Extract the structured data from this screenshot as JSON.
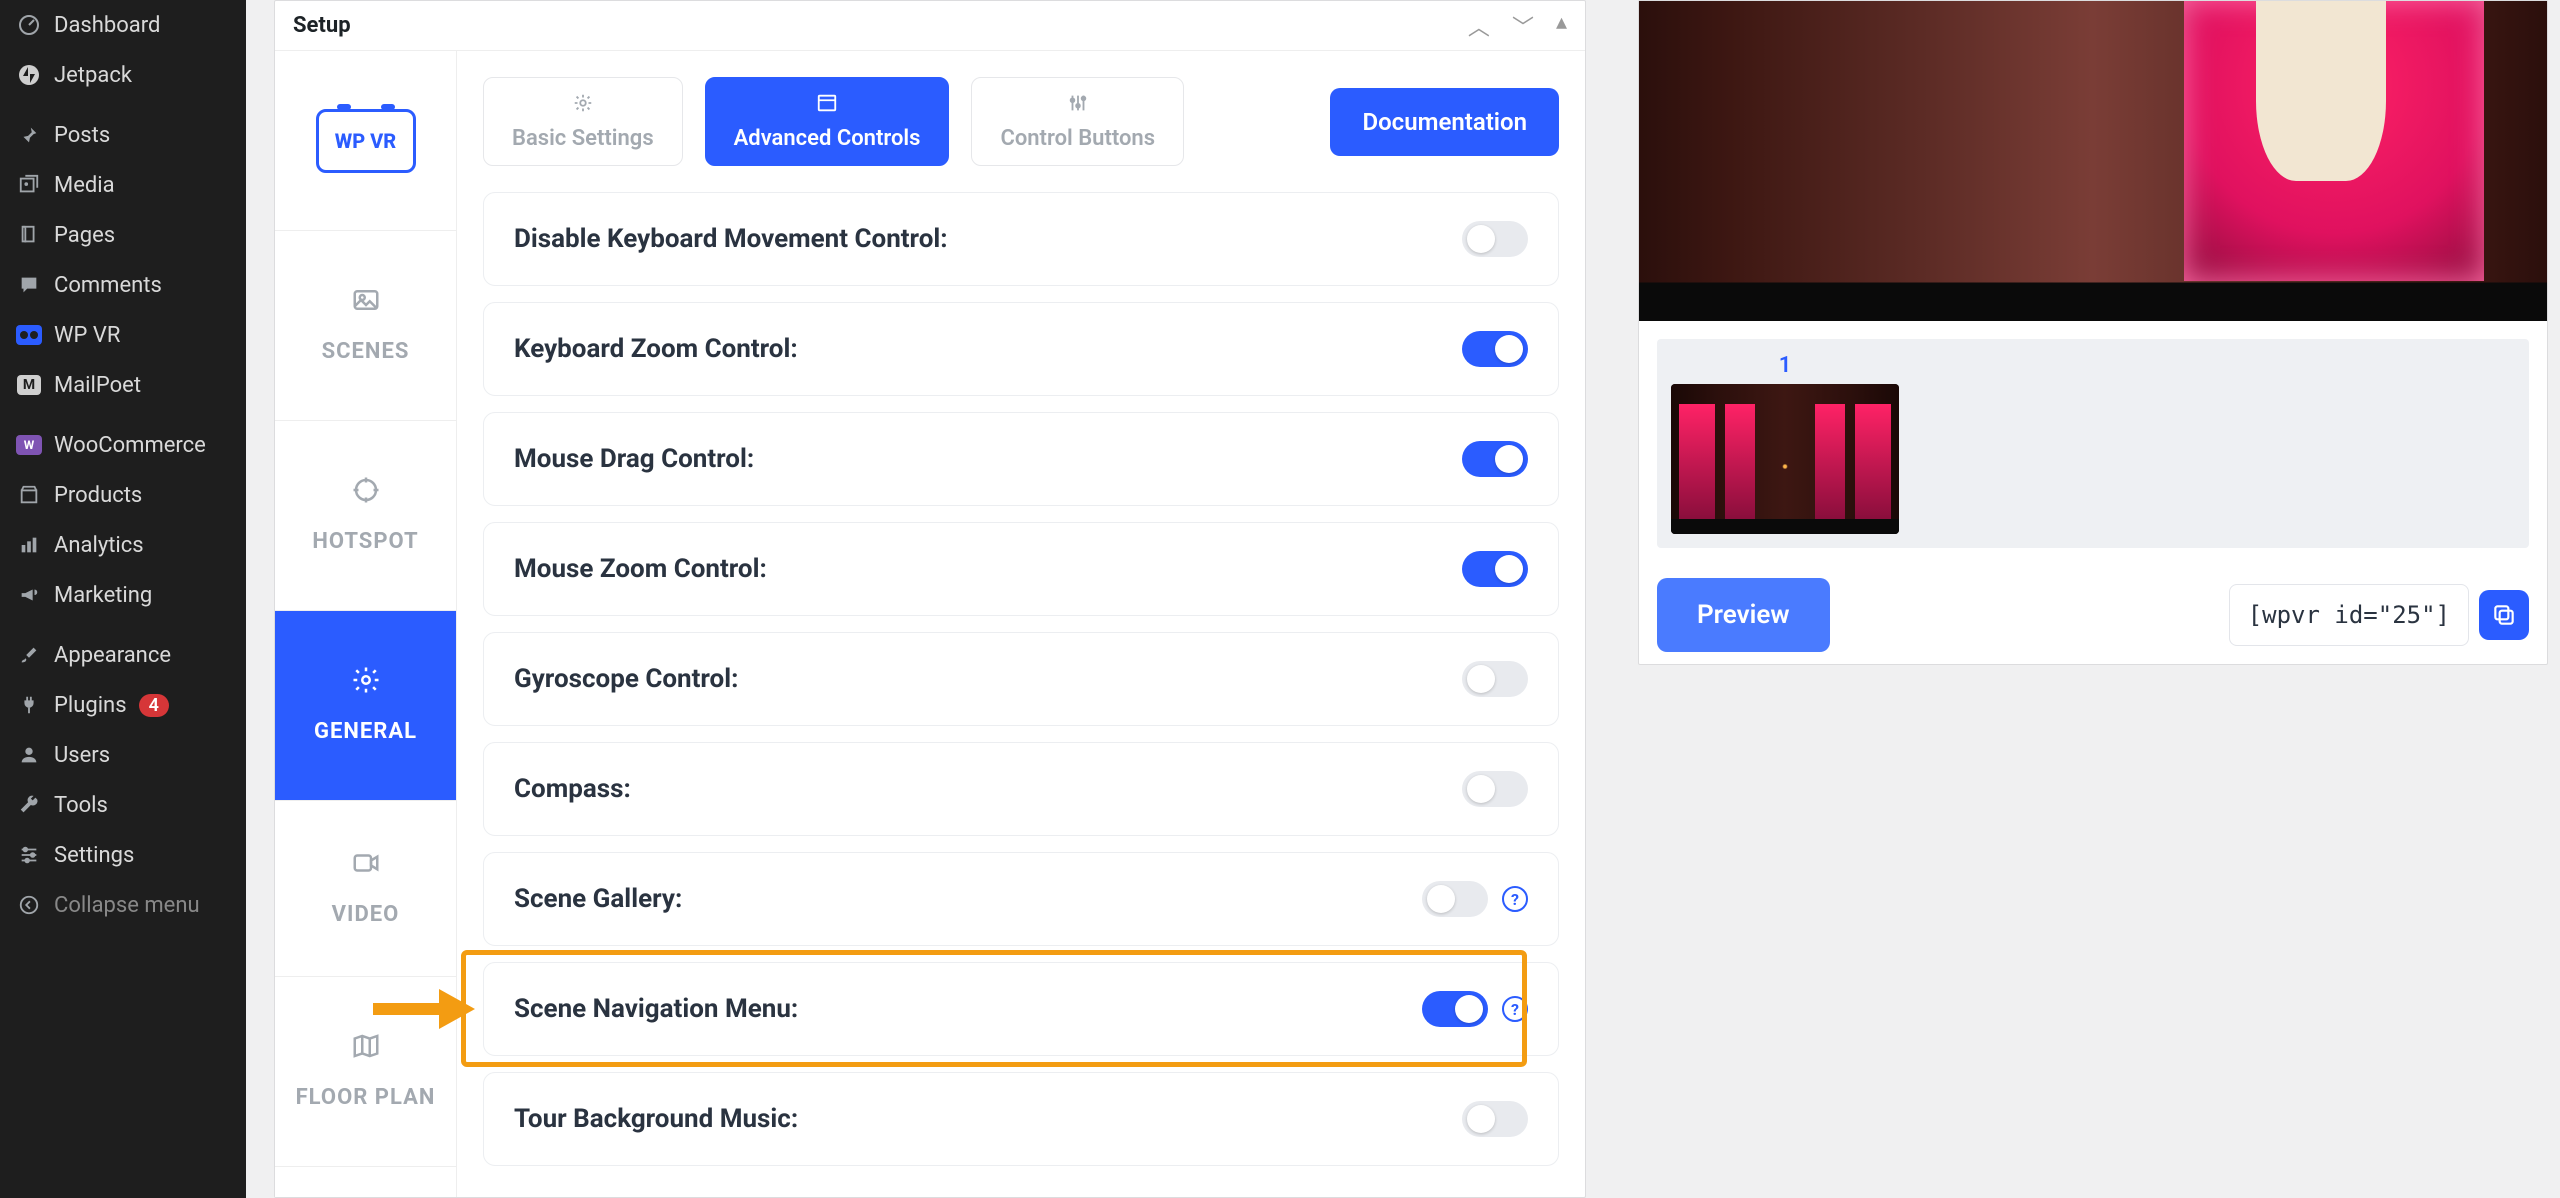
{
  "wp_menu": {
    "dashboard": "Dashboard",
    "jetpack": "Jetpack",
    "posts": "Posts",
    "media": "Media",
    "pages": "Pages",
    "comments": "Comments",
    "wpvr": "WP VR",
    "mailpoet": "MailPoet",
    "woocommerce": "WooCommerce",
    "products": "Products",
    "analytics": "Analytics",
    "marketing": "Marketing",
    "appearance": "Appearance",
    "plugins": "Plugins",
    "plugins_badge": "4",
    "users": "Users",
    "tools": "Tools",
    "settings": "Settings",
    "collapse": "Collapse menu"
  },
  "panel": {
    "title": "Setup",
    "logo_text": "WP VR"
  },
  "vtabs": {
    "scenes": "SCENES",
    "hotspot": "HOTSPOT",
    "general": "GENERAL",
    "video": "VIDEO",
    "floorplan": "FLOOR PLAN"
  },
  "htabs": {
    "basic": "Basic Settings",
    "advanced": "Advanced Controls",
    "controlbtns": "Control Buttons",
    "doc": "Documentation"
  },
  "rows": {
    "disable_keyboard": "Disable Keyboard Movement Control:",
    "keyboard_zoom": "Keyboard Zoom Control:",
    "mouse_drag": "Mouse Drag Control:",
    "mouse_zoom": "Mouse Zoom Control:",
    "gyroscope": "Gyroscope Control:",
    "compass": "Compass:",
    "scene_gallery": "Scene Gallery:",
    "scene_nav": "Scene Navigation Menu:",
    "bgmusic": "Tour Background Music:"
  },
  "toggles": {
    "disable_keyboard": false,
    "keyboard_zoom": true,
    "mouse_drag": true,
    "mouse_zoom": true,
    "gyroscope": false,
    "compass": false,
    "scene_gallery": false,
    "scene_nav": true,
    "bgmusic": false
  },
  "preview": {
    "thumb_index": "1",
    "button": "Preview",
    "shortcode": "[wpvr id=\"25\"]"
  }
}
